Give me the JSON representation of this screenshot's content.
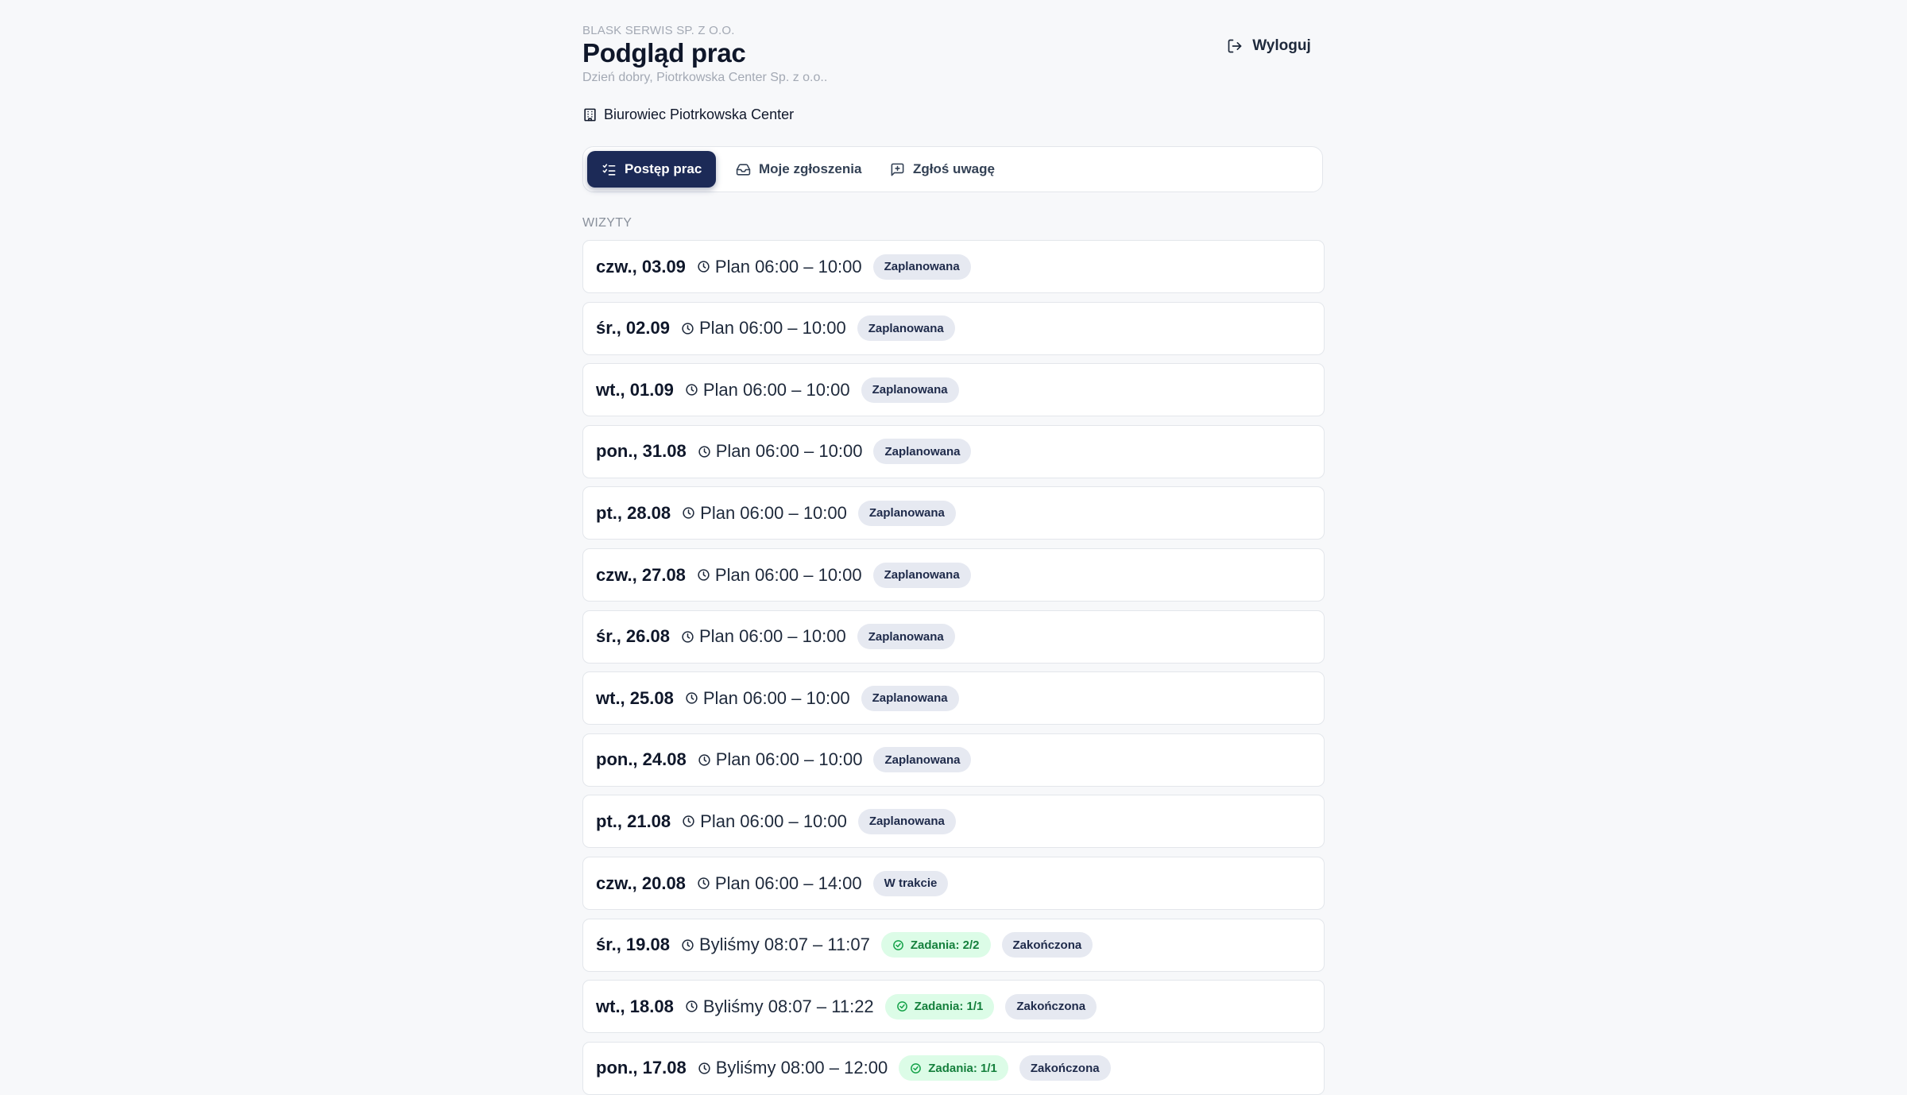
{
  "header": {
    "company": "BLASK SERWIS SP. Z O.O.",
    "title": "Podgląd prac",
    "greeting": "Dzień dobry, Piotrkowska Center Sp. z o.o..",
    "logout_label": "Wyloguj"
  },
  "location": {
    "label": "Biurowiec Piotrkowska Center",
    "icon": "building-icon"
  },
  "tabs": [
    {
      "label": "Postęp prac",
      "icon": "list-checks-icon",
      "active": true
    },
    {
      "label": "Moje zgłoszenia",
      "icon": "inbox-icon",
      "active": false
    },
    {
      "label": "Zgłoś uwagę",
      "icon": "message-plus-icon",
      "active": false
    }
  ],
  "section_label": "WIZYTY",
  "colors": {
    "primary": "#1c2a57",
    "success_bg": "#dcfce7",
    "success_text": "#15803d",
    "status_bg": "#e6e9f1"
  },
  "visits": [
    {
      "date": "czw., 03.09",
      "time": "Plan 06:00 – 10:00",
      "tasks": null,
      "status": "Zaplanowana"
    },
    {
      "date": "śr., 02.09",
      "time": "Plan 06:00 – 10:00",
      "tasks": null,
      "status": "Zaplanowana"
    },
    {
      "date": "wt., 01.09",
      "time": "Plan 06:00 – 10:00",
      "tasks": null,
      "status": "Zaplanowana"
    },
    {
      "date": "pon., 31.08",
      "time": "Plan 06:00 – 10:00",
      "tasks": null,
      "status": "Zaplanowana"
    },
    {
      "date": "pt., 28.08",
      "time": "Plan 06:00 – 10:00",
      "tasks": null,
      "status": "Zaplanowana"
    },
    {
      "date": "czw., 27.08",
      "time": "Plan 06:00 – 10:00",
      "tasks": null,
      "status": "Zaplanowana"
    },
    {
      "date": "śr., 26.08",
      "time": "Plan 06:00 – 10:00",
      "tasks": null,
      "status": "Zaplanowana"
    },
    {
      "date": "wt., 25.08",
      "time": "Plan 06:00 – 10:00",
      "tasks": null,
      "status": "Zaplanowana"
    },
    {
      "date": "pon., 24.08",
      "time": "Plan 06:00 – 10:00",
      "tasks": null,
      "status": "Zaplanowana"
    },
    {
      "date": "pt., 21.08",
      "time": "Plan 06:00 – 10:00",
      "tasks": null,
      "status": "Zaplanowana"
    },
    {
      "date": "czw., 20.08",
      "time": "Plan 06:00 – 14:00",
      "tasks": null,
      "status": "W trakcie"
    },
    {
      "date": "śr., 19.08",
      "time": "Byliśmy 08:07 – 11:07",
      "tasks": "Zadania: 2/2",
      "status": "Zakończona"
    },
    {
      "date": "wt., 18.08",
      "time": "Byliśmy 08:07 – 11:22",
      "tasks": "Zadania: 1/1",
      "status": "Zakończona"
    },
    {
      "date": "pon., 17.08",
      "time": "Byliśmy 08:00 – 12:00",
      "tasks": "Zadania: 1/1",
      "status": "Zakończona"
    }
  ]
}
